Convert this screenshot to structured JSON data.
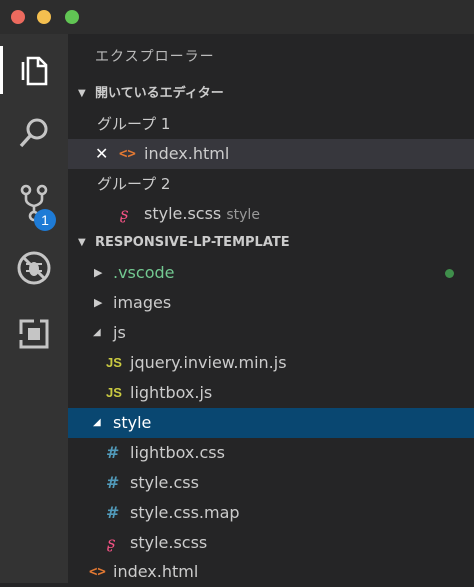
{
  "window": {
    "controls": [
      "close",
      "minimize",
      "maximize"
    ]
  },
  "activity_bar": {
    "items": [
      {
        "name": "explorer",
        "icon": "files-icon",
        "active": true
      },
      {
        "name": "search",
        "icon": "search-icon"
      },
      {
        "name": "source-control",
        "icon": "source-control-icon",
        "badge": "1"
      },
      {
        "name": "debug",
        "icon": "no-bug-icon"
      },
      {
        "name": "extensions",
        "icon": "extensions-icon"
      }
    ]
  },
  "explorer": {
    "title": "エクスプローラー",
    "open_editors": {
      "header": "開いているエディター",
      "group1": "グループ 1",
      "group1_file": "index.html",
      "group2": "グループ 2",
      "group2_file": "style.scss",
      "group2_file_desc": "style"
    },
    "project": {
      "header": "RESPONSIVE-LP-TEMPLATE",
      "items": {
        "vscode": ".vscode",
        "images": "images",
        "js": "js",
        "js_file1": "jquery.inview.min.js",
        "js_file2": "lightbox.js",
        "style": "style",
        "style_file1": "lightbox.css",
        "style_file2": "style.css",
        "style_file3": "style.css.map",
        "style_file4": "style.scss",
        "root_file": "index.html"
      }
    }
  },
  "colors": {
    "accent": "#094771",
    "git_modified": "#73c991",
    "badge": "#1e7bd6"
  }
}
